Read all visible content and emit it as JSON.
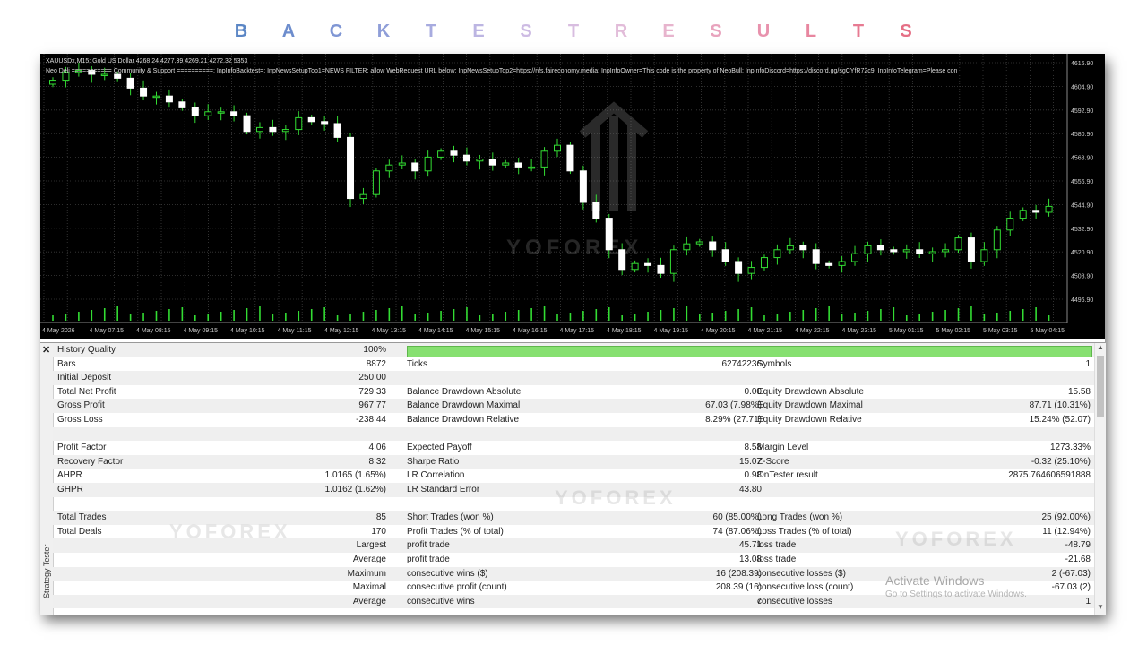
{
  "title_letters": [
    {
      "ch": "B",
      "color": "#5b86c5"
    },
    {
      "ch": "A",
      "color": "#6d8dcd"
    },
    {
      "ch": "C",
      "color": "#7f96d4"
    },
    {
      "ch": "K",
      "color": "#8f9ed8"
    },
    {
      "ch": "T",
      "color": "#a7abdf"
    },
    {
      "ch": "E",
      "color": "#bcb5e2"
    },
    {
      "ch": "S",
      "color": "#cdbbe3"
    },
    {
      "ch": "T",
      "color": "#d8bde0"
    },
    {
      "ch": "R",
      "color": "#e2bcd9"
    },
    {
      "ch": "E",
      "color": "#e7b4cd"
    },
    {
      "ch": "S",
      "color": "#e8a3bd"
    },
    {
      "ch": "U",
      "color": "#e892ad"
    },
    {
      "ch": "L",
      "color": "#e8869f"
    },
    {
      "ch": "T",
      "color": "#e77a92"
    },
    {
      "ch": "S",
      "color": "#e56f85"
    }
  ],
  "chart": {
    "info_line": "XAUUSDx,M15:  Gold US Dollar  4268.24 4277.39 4269.21 4272.32  5353",
    "params_line": "Neo Deli =========== Community & Support ==========; InpInfoBacktest=; InpNewsSetupTop1=NEWS FILTER: allow WebRequest URL below; InpNewsSetupTop2=https://nfs.faireconomy.media; InpInfoOwner=This code is the property of NeoBull; InpInfoDiscord=https://discord.gg/sgCYfR72c9; InpInfoTelegram=Please con",
    "price_labels": [
      "4616.90",
      "4604.90",
      "4592.90",
      "4580.90",
      "4568.90",
      "4556.90",
      "4544.90",
      "4532.90",
      "4520.90",
      "4508.90",
      "4496.90"
    ],
    "time_labels": [
      "4 May 2026",
      "4 May 07:15",
      "4 May 08:15",
      "4 May 09:15",
      "4 May 10:15",
      "4 May 11:15",
      "4 May 12:15",
      "4 May 13:15",
      "4 May 14:15",
      "4 May 15:15",
      "4 May 16:15",
      "4 May 17:15",
      "4 May 18:15",
      "4 May 19:15",
      "4 May 20:15",
      "4 May 21:15",
      "4 May 22:15",
      "4 May 23:15",
      "5 May 01:15",
      "5 May 02:15",
      "5 May 03:15",
      "5 May 04:15"
    ],
    "candles_close": [
      4608,
      4612,
      4613,
      4611,
      4611,
      4609,
      4604,
      4600,
      4600,
      4597,
      4594,
      4590,
      4592,
      4592,
      4590,
      4582,
      4584,
      4582,
      4583,
      4589,
      4587,
      4586,
      4579,
      4548,
      4550,
      4562,
      4565,
      4566,
      4562,
      4569,
      4572,
      4570,
      4567,
      4568,
      4565,
      4566,
      4564,
      4564,
      4572,
      4575,
      4562,
      4546,
      4538,
      4522,
      4512,
      4515,
      4514,
      4510,
      4522,
      4525,
      4526,
      4522,
      4516,
      4510,
      4513,
      4518,
      4522,
      4524,
      4522,
      4515,
      4514,
      4516,
      4520,
      4524,
      4522,
      4521,
      4522,
      4520,
      4521,
      4522,
      4528,
      4516,
      4522,
      4532,
      4538,
      4542,
      4541,
      4544
    ],
    "watermark": "YOFOREX",
    "colors": {
      "background": "#000000",
      "grid": "#3c3c3c",
      "candle_up": "#000000",
      "candle_down": "#ffffff",
      "wick": "#33dd33",
      "volume": "#33dd33",
      "axis_text": "#cccccc"
    }
  },
  "tester": {
    "side_label": "Strategy Tester",
    "history_quality": {
      "label": "History Quality",
      "value": "100%",
      "fraction": 1.0
    },
    "rows": [
      {
        "l1": "Bars",
        "v1": "8872",
        "l2": "Ticks",
        "v2": "62742236",
        "l3": "Symbols",
        "v3": "1"
      },
      {
        "l1": "Initial Deposit",
        "v1": "250.00",
        "l2": "",
        "v2": "",
        "l3": "",
        "v3": ""
      },
      {
        "l1": "Total Net Profit",
        "v1": "729.33",
        "l2": "Balance Drawdown Absolute",
        "v2": "0.00",
        "l3": "Equity Drawdown Absolute",
        "v3": "15.58"
      },
      {
        "l1": "Gross Profit",
        "v1": "967.77",
        "l2": "Balance Drawdown Maximal",
        "v2": "67.03 (7.98%)",
        "l3": "Equity Drawdown Maximal",
        "v3": "87.71 (10.31%)"
      },
      {
        "l1": "Gross Loss",
        "v1": "-238.44",
        "l2": "Balance Drawdown Relative",
        "v2": "8.29% (27.71)",
        "l3": "Equity Drawdown Relative",
        "v3": "15.24% (52.07)"
      },
      {
        "l1": "",
        "v1": "",
        "l2": "",
        "v2": "",
        "l3": "",
        "v3": ""
      },
      {
        "l1": "Profit Factor",
        "v1": "4.06",
        "l2": "Expected Payoff",
        "v2": "8.58",
        "l3": "Margin Level",
        "v3": "1273.33%"
      },
      {
        "l1": "Recovery Factor",
        "v1": "8.32",
        "l2": "Sharpe Ratio",
        "v2": "15.07",
        "l3": "Z-Score",
        "v3": "-0.32 (25.10%)"
      },
      {
        "l1": "AHPR",
        "v1": "1.0165 (1.65%)",
        "l2": "LR Correlation",
        "v2": "0.98",
        "l3": "OnTester result",
        "v3": "2875.764606591888"
      },
      {
        "l1": "GHPR",
        "v1": "1.0162 (1.62%)",
        "l2": "LR Standard Error",
        "v2": "43.80",
        "l3": "",
        "v3": ""
      },
      {
        "l1": "",
        "v1": "",
        "l2": "",
        "v2": "",
        "l3": "",
        "v3": ""
      },
      {
        "l1": "Total Trades",
        "v1": "85",
        "l2": "Short Trades (won %)",
        "v2": "60 (85.00%)",
        "l3": "Long Trades (won %)",
        "v3": "25 (92.00%)"
      },
      {
        "l1": "Total Deals",
        "v1": "170",
        "l2": "Profit Trades (% of total)",
        "v2": "74 (87.06%)",
        "l3": "Loss Trades (% of total)",
        "v3": "11 (12.94%)"
      },
      {
        "l1": "",
        "v1": "Largest",
        "l2": "profit trade",
        "v2": "45.71",
        "l3": "loss trade",
        "v3": "-48.79"
      },
      {
        "l1": "",
        "v1": "Average",
        "l2": "profit trade",
        "v2": "13.08",
        "l3": "loss trade",
        "v3": "-21.68"
      },
      {
        "l1": "",
        "v1": "Maximum",
        "l2": "consecutive wins ($)",
        "v2": "16 (208.39)",
        "l3": "consecutive losses ($)",
        "v3": "2 (-67.03)"
      },
      {
        "l1": "",
        "v1": "Maximal",
        "l2": "consecutive profit (count)",
        "v2": "208.39 (16)",
        "l3": "consecutive loss (count)",
        "v3": "-67.03 (2)"
      },
      {
        "l1": "",
        "v1": "Average",
        "l2": "consecutive wins",
        "v2": "7",
        "l3": "consecutive losses",
        "v3": "1"
      }
    ],
    "watermark": "YOFOREX",
    "activate_title": "Activate Windows",
    "activate_sub": "Go to Settings to activate Windows."
  }
}
